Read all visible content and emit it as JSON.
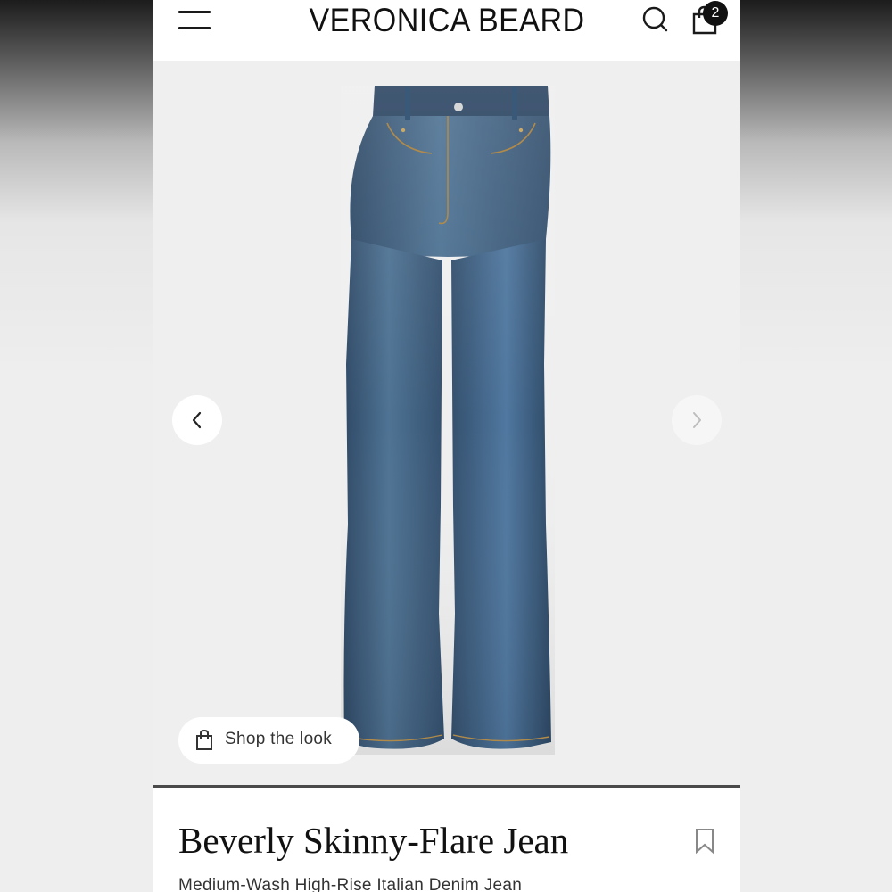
{
  "header": {
    "brand": "VERONICA BEARD",
    "cart_count": "2",
    "menu_icon": "hamburger-menu-icon",
    "search_icon": "search-icon",
    "cart_icon": "shopping-bag-icon"
  },
  "gallery": {
    "image": "medium-wash-flare-jeans",
    "prev_icon": "chevron-left-icon",
    "next_icon": "chevron-right-icon",
    "shop_the_look_label": "Shop the look",
    "shop_icon": "shopping-bag-icon"
  },
  "product": {
    "title": "Beverly Skinny-Flare Jean",
    "subtitle": "Medium-Wash High-Rise Italian Denim Jean",
    "bookmark_icon": "bookmark-icon"
  },
  "colors": {
    "page_bg": "#ffffff",
    "gallery_bg": "#efefef",
    "denim": "#3f5f80",
    "text": "#111111"
  }
}
